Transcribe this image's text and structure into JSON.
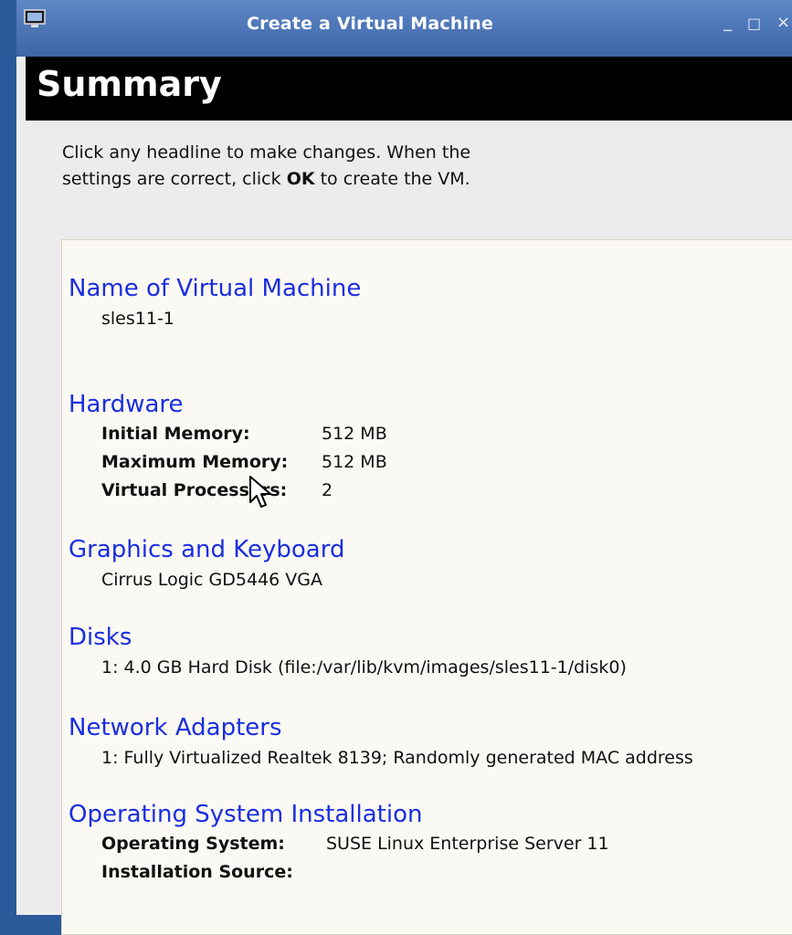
{
  "window": {
    "title": "Create a Virtual Machine",
    "controls": {
      "minimize": "_",
      "maximize": "□",
      "close": "×"
    }
  },
  "header": {
    "title": "Summary"
  },
  "instructions": {
    "before_ok": "Click any headline to make changes.  When the settings are correct, click ",
    "ok": "OK",
    "after_ok": " to create the VM."
  },
  "summary": {
    "name": {
      "headline": "Name of Virtual Machine",
      "value": "sles11-1"
    },
    "hardware": {
      "headline": "Hardware",
      "rows": [
        {
          "label": "Initial Memory:",
          "value": "512 MB"
        },
        {
          "label": "Maximum Memory:",
          "value": "512 MB"
        },
        {
          "label": "Virtual Processors:",
          "value": "2"
        }
      ]
    },
    "graphics": {
      "headline": "Graphics and Keyboard",
      "value": "Cirrus Logic GD5446 VGA"
    },
    "disks": {
      "headline": "Disks",
      "value": "1: 4.0 GB Hard Disk (file:/var/lib/kvm/images/sles11-1/disk0)"
    },
    "network": {
      "headline": "Network Adapters",
      "value": "1: Fully Virtualized Realtek 8139; Randomly generated MAC address"
    },
    "os": {
      "headline": "Operating System Installation",
      "rows": [
        {
          "label": "Operating System:",
          "value": "SUSE Linux Enterprise Server 11"
        },
        {
          "label": "Installation Source:",
          "value": ""
        }
      ]
    }
  }
}
